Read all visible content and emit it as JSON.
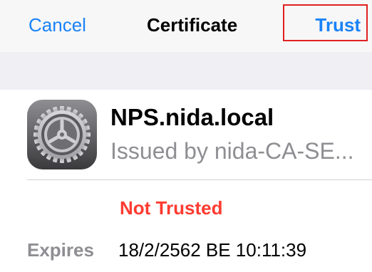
{
  "navbar": {
    "cancel_label": "Cancel",
    "title": "Certificate",
    "trust_label": "Trust"
  },
  "certificate": {
    "icon": "settings-gear-icon",
    "name": "NPS.nida.local",
    "issuer": "Issued by nida-CA-SE...",
    "status": "Not Trusted",
    "expires_label": "Expires",
    "expires_value": "18/2/2562 BE 10:11:39"
  },
  "colors": {
    "accent": "#1a82f7",
    "danger": "#ff3b30",
    "secondary_text": "#8e8e93",
    "highlight_box": "#e02020"
  }
}
